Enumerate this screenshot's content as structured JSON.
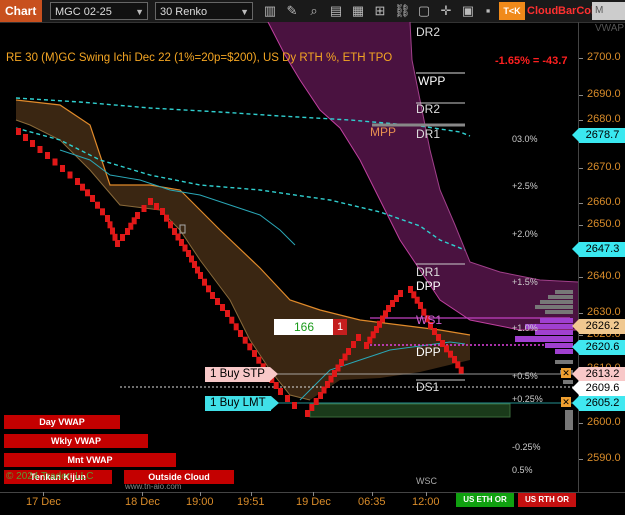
{
  "toolbar": {
    "chart_tab": "Chart",
    "instrument": "MGC 02-25",
    "bar_type": "30 Renko",
    "tk_label": "T<K",
    "cloud_label": "Cloud",
    "barcol_label": "BarCol",
    "vwap_label": "M VWAP"
  },
  "chart": {
    "title": "RE 30 (M)GC Swing Ichi Dec 22 (1%=20p=$200), US Dy RTH %, ETH TPO",
    "change": "-1.65% = -43.7",
    "levels": {
      "dr2_top": "DR2",
      "wpp": "WPP",
      "dr2": "DR2",
      "mpp": "MPP",
      "dr1_top": "DR1",
      "dr1": "DR1",
      "dpp_top": "DPP",
      "ws1": "WS1",
      "dpp": "DPP",
      "ds1": "DS1",
      "wsc": "WSC"
    },
    "percent_labels": [
      "03.0%",
      "+2.5%",
      "+2.0%",
      "+1.5%",
      "+1.0%",
      "+0.5%",
      "+0.25%",
      "-0.25%",
      "0.5%"
    ],
    "y_ticks": [
      "2700.0",
      "2690.0",
      "2680.0",
      "2670.0",
      "2660.0",
      "2650.0",
      "2640.0",
      "2630.0",
      "2620.0",
      "2610.0",
      "2600.0",
      "2590.0"
    ],
    "price_tags": {
      "p1": "2678.7",
      "p2": "2647.3",
      "p3": "2626.2",
      "p4": "2620.6",
      "p5": "2613.2",
      "p6": "2609.6",
      "p7": "2605.2"
    },
    "x_ticks": [
      "17 Dec",
      "18 Dec",
      "19:00",
      "19:51",
      "19 Dec",
      "06:35",
      "12:00"
    ],
    "order_qty": "166",
    "order_qty_badge": "1",
    "buy_stp": "1 Buy STP",
    "buy_lmt": "1 Buy LMT",
    "buttons": {
      "day_vwap": "Day VWAP",
      "wkly_vwap": "Wkly VWAP",
      "mnt_vwap": "Mnt VWAP",
      "tenkan_kijun": "Tenkan Kijun",
      "outside_cloud": "Outside Cloud",
      "us_eth_or": "US ETH OR",
      "us_rth_or": "US RTH OR"
    },
    "copyright": "© 2024 Trader, LLC",
    "website": "www.tn-aio.com"
  }
}
